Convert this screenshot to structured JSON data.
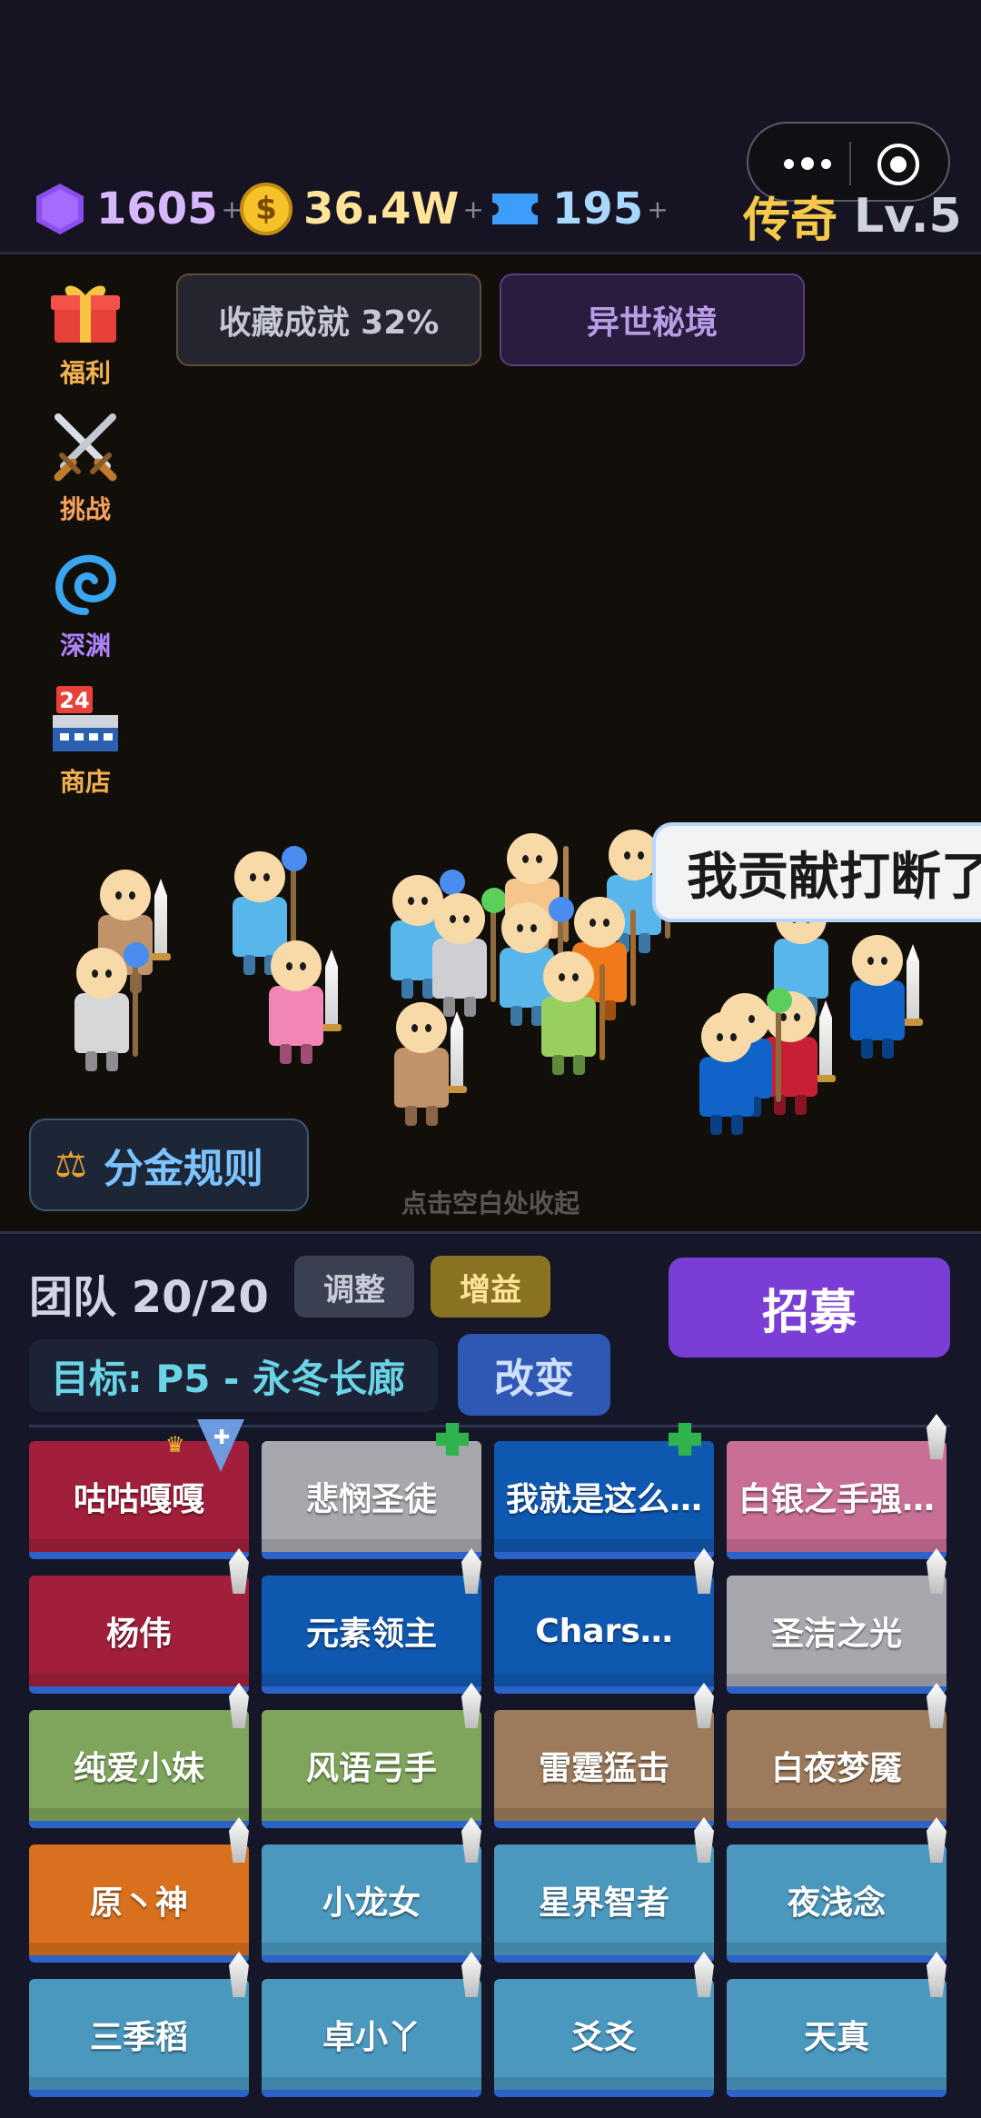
{
  "header": {
    "resources": {
      "gem": {
        "value": "1605",
        "plus": "+",
        "icon": "purple-hexagon-gem-icon",
        "color": "#d7b8ff"
      },
      "gold": {
        "value": "36.4W",
        "plus": "+",
        "icon": "gold-coin-icon",
        "color": "#ffe49a"
      },
      "ticket": {
        "value": "195",
        "plus": "+",
        "icon": "blue-ticket-icon",
        "color": "#a9d8ff"
      }
    },
    "rank_title": "传奇",
    "level": "Lv.5"
  },
  "sidebar": [
    {
      "label": "福利",
      "icon": "gift-icon"
    },
    {
      "label": "挑战",
      "icon": "crossed-swords-icon"
    },
    {
      "label": "深渊",
      "icon": "vortex-icon"
    },
    {
      "label": "商店",
      "icon": "shop-calendar-icon",
      "badge": "24"
    }
  ],
  "top_buttons": {
    "achievement": "收藏成就 32%",
    "secret_realm": "异世秘境"
  },
  "battle": {
    "speech_bubble": "我贡献打断了",
    "rules_button": "分金规则",
    "rules_icon": "scales-icon",
    "collapse_hint": "点击空白处收起"
  },
  "team_panel": {
    "team_label": "团队 20/20",
    "adjust": "调整",
    "buff": "增益",
    "recruit": "招募",
    "target": "目标: P5 - 永冬长廊",
    "change": "改变"
  },
  "members": [
    {
      "name": "咕咕嘎嘎",
      "color": "#a11f3a",
      "marker": "crown-shield"
    },
    {
      "name": "悲悯圣徒",
      "color": "#a7a7ad",
      "marker": "heal"
    },
    {
      "name": "我就是这么…",
      "color": "#0f58b0",
      "marker": "heal"
    },
    {
      "name": "白银之手强…",
      "color": "#c96f96",
      "marker": "sword"
    },
    {
      "name": "杨伟",
      "color": "#a11f3a",
      "marker": "sword"
    },
    {
      "name": "元素领主",
      "color": "#0f58b0",
      "marker": "sword"
    },
    {
      "name": "Chars…",
      "color": "#0f58b0",
      "marker": "sword"
    },
    {
      "name": "圣洁之光",
      "color": "#a7a7ad",
      "marker": "sword"
    },
    {
      "name": "纯爱小妹",
      "color": "#7fa55c",
      "marker": "sword"
    },
    {
      "name": "风语弓手",
      "color": "#7fa55c",
      "marker": "sword"
    },
    {
      "name": "雷霆猛击",
      "color": "#9c7a5b",
      "marker": "sword"
    },
    {
      "name": "白夜梦魇",
      "color": "#9c7a5b",
      "marker": "sword"
    },
    {
      "name": "原丶神",
      "color": "#d8701d",
      "marker": "sword"
    },
    {
      "name": "小龙女",
      "color": "#4b98bf",
      "marker": "sword"
    },
    {
      "name": "星界智者",
      "color": "#4b98bf",
      "marker": "sword"
    },
    {
      "name": "夜浅念",
      "color": "#4b98bf",
      "marker": "sword"
    },
    {
      "name": "三季稻",
      "color": "#4b98bf",
      "marker": "sword"
    },
    {
      "name": "卓小丫",
      "color": "#4b98bf",
      "marker": "sword"
    },
    {
      "name": "爻爻",
      "color": "#4b98bf",
      "marker": "sword"
    },
    {
      "name": "天真",
      "color": "#4b98bf",
      "marker": "sword"
    }
  ]
}
